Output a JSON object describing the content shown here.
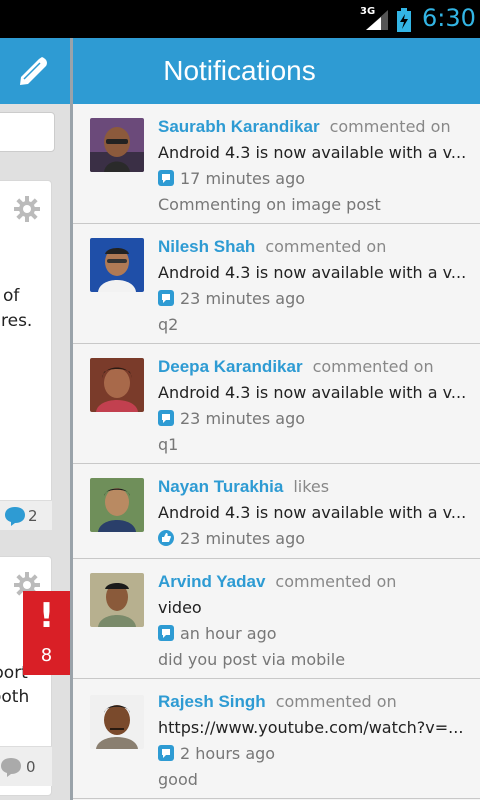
{
  "status_bar": {
    "network": "3G",
    "time": "6:30"
  },
  "background_panel": {
    "card1_lines": [
      "of",
      "res."
    ],
    "card1_comment_count": "2",
    "card2_lines": [
      "port",
      "ooth"
    ],
    "card2_comment_count": "0"
  },
  "alert_badge": {
    "mark": "!",
    "count": "8"
  },
  "header": {
    "title": "Notifications"
  },
  "notifications": [
    {
      "name": "Saurabh Karandikar",
      "action": "commented on",
      "snippet": "Android 4.3 is now available with a v...",
      "time": "17 minutes ago",
      "time_icon": "comment-icon",
      "extra": "Commenting on image post"
    },
    {
      "name": "Nilesh Shah",
      "action": "commented on",
      "snippet": "Android 4.3 is now available with a v...",
      "time": "23 minutes ago",
      "time_icon": "comment-icon",
      "extra": "q2"
    },
    {
      "name": "Deepa Karandikar",
      "action": "commented on",
      "snippet": "Android 4.3 is now available with a v...",
      "time": "23 minutes ago",
      "time_icon": "comment-icon",
      "extra": "q1"
    },
    {
      "name": "Nayan Turakhia",
      "action": "likes",
      "snippet": "Android 4.3 is now available with a v...",
      "time": "23 minutes ago",
      "time_icon": "like-icon",
      "extra": ""
    },
    {
      "name": "Arvind Yadav",
      "action": "commented on",
      "snippet": "video",
      "time": "an hour ago",
      "time_icon": "comment-icon",
      "extra": "did you post via mobile"
    },
    {
      "name": "Rajesh Singh",
      "action": "commented on",
      "snippet": "https://www.youtube.com/watch?v=...",
      "time": "2 hours ago",
      "time_icon": "comment-icon",
      "extra": "good"
    }
  ],
  "colors": {
    "accent": "#2e9bd3",
    "alert": "#d91f26",
    "status_time": "#33b5e5"
  }
}
